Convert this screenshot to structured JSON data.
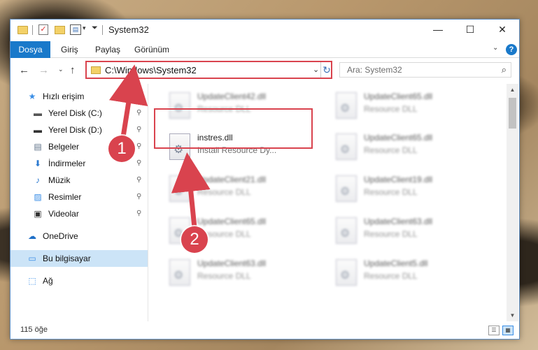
{
  "window": {
    "title": "System32",
    "controls": {
      "minimize": "—",
      "maximize": "☐",
      "close": "✕"
    }
  },
  "ribbon": {
    "tabs": [
      "Dosya",
      "Giriş",
      "Paylaş",
      "Görünüm"
    ],
    "expand_glyph": "⌄",
    "help_glyph": "?"
  },
  "navigation": {
    "back": "←",
    "forward": "→",
    "recent": "⌄",
    "up": "↑",
    "address": "C:\\Windows\\System32",
    "address_dropdown": "⌄",
    "refresh": "↻",
    "search_placeholder": "Ara: System32"
  },
  "sidebar": {
    "quick_access": "Hızlı erişim",
    "items": [
      {
        "label": "Yerel Disk (C:)",
        "pinned": true
      },
      {
        "label": "Yerel Disk (D:)",
        "pinned": true
      },
      {
        "label": "Belgeler",
        "pinned": true
      },
      {
        "label": "İndirmeler",
        "pinned": true
      },
      {
        "label": "Müzik",
        "pinned": true
      },
      {
        "label": "Resimler",
        "pinned": true
      },
      {
        "label": "Videolar",
        "pinned": true
      }
    ],
    "onedrive": "OneDrive",
    "this_pc": "Bu bilgisayar",
    "network": "Ağ",
    "pin_glyph": "📌"
  },
  "files": {
    "left": [
      {
        "name": "UpdateClient42.dll",
        "type": "Resource DLL"
      },
      {
        "name": "instres.dll",
        "type": "Install Resource Dy..."
      },
      {
        "name": "UpdateClient21.dll",
        "type": "Resource DLL"
      },
      {
        "name": "UpdateClient65.dll",
        "type": "Resource DLL"
      },
      {
        "name": "UpdateClient63.dll",
        "type": "Resource DLL"
      }
    ],
    "right": [
      {
        "name": "UpdateClient65.dll",
        "type": "Resource DLL"
      },
      {
        "name": "UpdateClient65.dll",
        "type": "Resource DLL"
      },
      {
        "name": "UpdateClient19.dll",
        "type": "Resource DLL"
      },
      {
        "name": "UpdateClient63.dll",
        "type": "Resource DLL"
      },
      {
        "name": "UpdateClient5.dll",
        "type": "Resource DLL"
      }
    ]
  },
  "status": {
    "item_count": "115 öğe"
  },
  "annotations": {
    "step1": "1",
    "step2": "2",
    "color": "#d9434e"
  }
}
